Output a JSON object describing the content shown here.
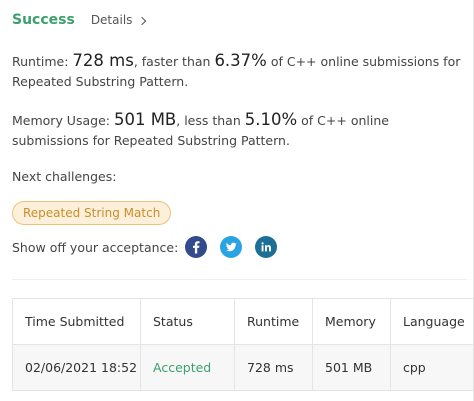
{
  "header": {
    "status": "Success",
    "details_label": "Details"
  },
  "runtime": {
    "prefix": "Runtime: ",
    "value": "728 ms",
    "mid": ", faster than ",
    "percent": "6.37%",
    "suffix": " of C++ online submissions for Repeated Substring Pattern."
  },
  "memory": {
    "prefix": "Memory Usage: ",
    "value": "501 MB",
    "mid": ", less than ",
    "percent": "5.10%",
    "suffix": " of C++ online submissions for Repeated Substring Pattern."
  },
  "next": {
    "label": "Next challenges:",
    "challenges": [
      "Repeated String Match"
    ]
  },
  "share": {
    "label": "Show off your acceptance:",
    "icons": [
      "facebook-icon",
      "twitter-icon",
      "linkedin-icon"
    ],
    "colors": {
      "facebook": "#324b8c",
      "twitter": "#2aa3e3",
      "linkedin": "#1d6f96"
    }
  },
  "table": {
    "headers": [
      "Time Submitted",
      "Status",
      "Runtime",
      "Memory",
      "Language"
    ],
    "rows": [
      [
        "02/06/2021 18:52",
        "Accepted",
        "728 ms",
        "501 MB",
        "cpp"
      ]
    ]
  },
  "colors": {
    "success": "#3c9f6d",
    "chip_bg": "#fdf0da",
    "chip_text": "#c98d2a"
  }
}
